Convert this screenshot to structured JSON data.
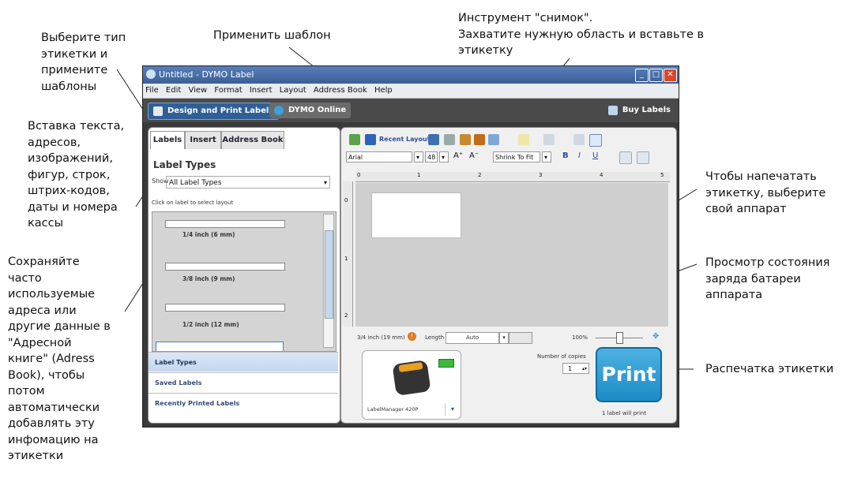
{
  "annotations": {
    "label_type": [
      "Выберите тип",
      "этикетки и",
      "примените",
      "шаблоны"
    ],
    "insert": [
      "Вставка текста,",
      "адресов,",
      "изображений,",
      "фигур, строк,",
      "штрих-кодов,",
      "даты и номера",
      "кассы"
    ],
    "address_book": [
      "Сохраняйте",
      "часто",
      "используемые",
      "адреса или",
      "другие данные в",
      "\"Адресной",
      "книге\" (Adress",
      "Book), чтобы",
      "потом",
      "автоматически",
      "добавлять эту",
      "инфомацию на",
      "этикетки"
    ],
    "apply_template": [
      "Применить шаблон"
    ],
    "snapshot": [
      "Инструмент \"снимок\".",
      "Захватите нужную область и вставьте в",
      "этикетку"
    ],
    "select_printer": [
      "Чтобы напечатать",
      "этикетку, выберите",
      "свой аппарат"
    ],
    "battery": [
      "Просмотр состояния",
      "заряда батареи",
      "аппарата"
    ],
    "print": [
      "Распечатка этикетки"
    ]
  },
  "window": {
    "title": "Untitled - DYMO Label"
  },
  "menu": [
    "File",
    "Edit",
    "View",
    "Format",
    "Insert",
    "Layout",
    "Address Book",
    "Help"
  ],
  "toolbar": {
    "design": "Design and Print Labels",
    "online": "DYMO Online",
    "buy": "Buy Labels"
  },
  "left": {
    "tabs": [
      "Labels",
      "Insert",
      "Address Book"
    ],
    "heading": "Label Types",
    "show_label": "Show",
    "show_value": "All Label Types",
    "hint": "Click on label to select layout",
    "labels": [
      "1/4 inch (6 mm)",
      "3/8 inch (9 mm)",
      "1/2 inch (12 mm)"
    ],
    "sections": [
      "Label Types",
      "Saved Labels",
      "Recently Printed Labels"
    ]
  },
  "editor": {
    "recent_layouts": "Recent Layouts",
    "font": "Arial",
    "font_size": "48",
    "fit": "Shrink To Fit",
    "ruler_h": [
      "0",
      "1",
      "2",
      "3",
      "4",
      "5"
    ],
    "ruler_v": [
      "0",
      "1",
      "2"
    ],
    "tape_width": "3/4 inch (19 mm)",
    "length_label": "Length",
    "length_value": "Auto",
    "zoom": "100%",
    "copies_label": "Number of copies",
    "copies_value": "1",
    "print_label": "Print",
    "printer_name": "LabelManager 420P",
    "print_status": "1 label will print"
  },
  "colors": {
    "accent": "#2a9bd6",
    "titlebar": "#4a6fa8",
    "battery": "#3cb83c",
    "caution": "#e07a1a"
  }
}
